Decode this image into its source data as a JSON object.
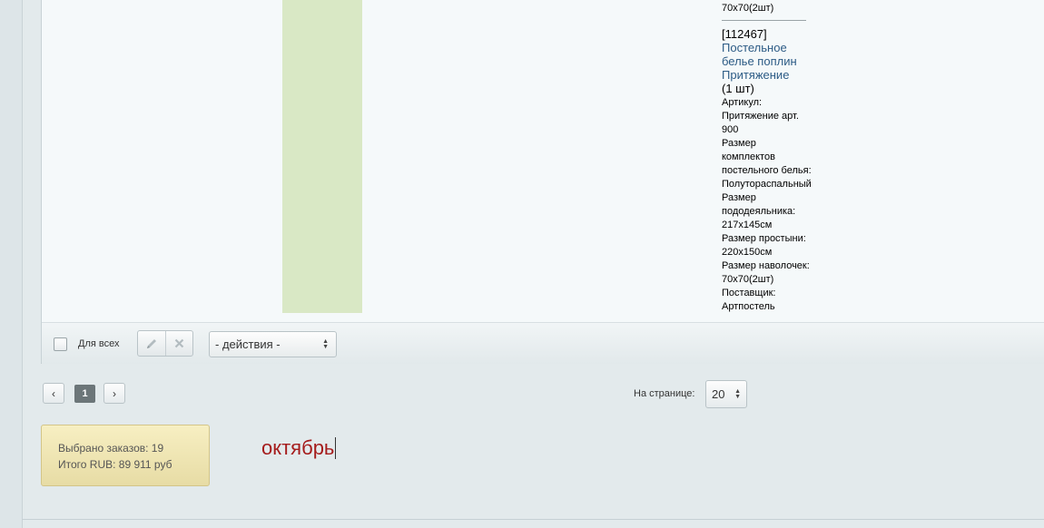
{
  "order_items": {
    "prev_item_tail": "70х70(2шт)",
    "item": {
      "code": "[112467]",
      "name_lines": [
        "Постельное",
        "белье поплин",
        "Притяжение"
      ],
      "qty": "(1 шт)",
      "props_lines": [
        "Артикул:",
        "Притяжение арт.",
        "900",
        "Размер",
        "комплектов",
        "постельного белья:",
        "Полутораспальный",
        "Размер",
        "пододеяльника:",
        "217х145см",
        "Размер простыни:",
        "220х150см",
        "Размер наволочек:",
        "70х70(2шт)",
        "Поставщик:",
        "Артпостель"
      ]
    }
  },
  "footer": {
    "for_all_label": "Для всех",
    "actions_select_value": "- действия -"
  },
  "pager": {
    "current_page": "1",
    "prev_glyph": "‹",
    "next_glyph": "›",
    "per_page_label": "На странице:",
    "per_page_value": "20"
  },
  "summary": {
    "selected_orders": "Выбрано заказов: 19",
    "total": "Итого RUB: 89 911 руб"
  },
  "note": "октябрь",
  "colors": {
    "link": "#2c5b85",
    "note": "#a51c1c",
    "green_column": "#d9e8c5",
    "summary_bg": "#efe5b3"
  }
}
